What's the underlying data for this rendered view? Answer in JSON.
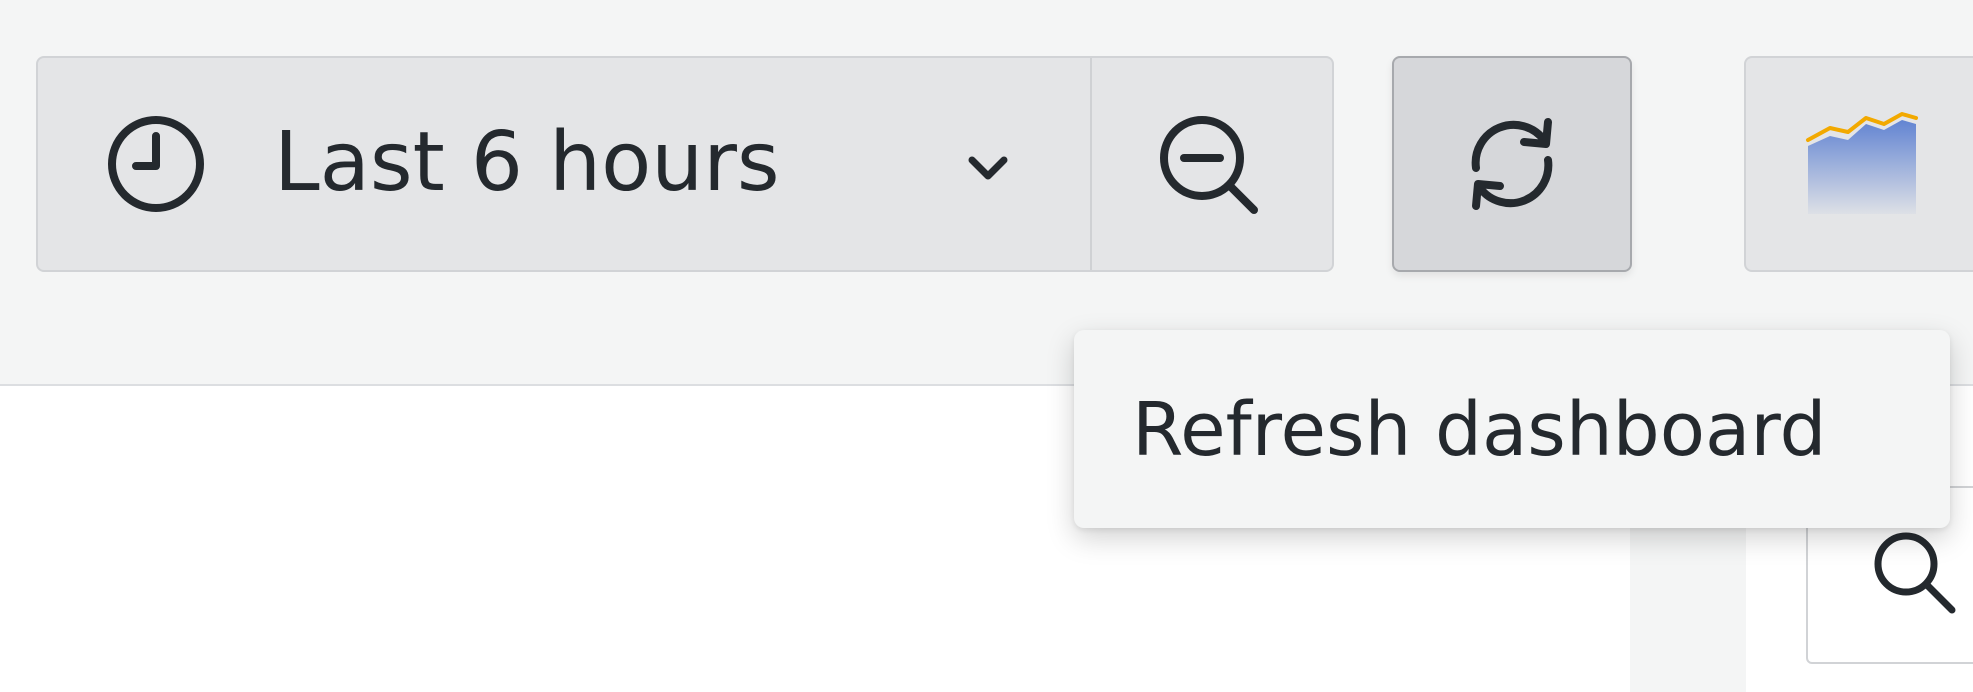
{
  "time_picker": {
    "label": "Last 6 hours",
    "icon": "clock-icon",
    "dropdown_icon": "chevron-down-icon"
  },
  "zoom_out": {
    "icon": "zoom-out-icon"
  },
  "refresh": {
    "icon": "refresh-icon",
    "tooltip": "Refresh dashboard"
  },
  "add_panel": {
    "icon": "chart-panel-icon"
  },
  "search": {
    "icon": "search-icon"
  },
  "colors": {
    "toolbar_bg": "#f4f5f5",
    "button_bg": "#e4e5e7",
    "active_button_bg": "#d6d7da",
    "text": "#24292e",
    "chart_line": "#f2a900",
    "chart_fill": "#5b7fd1"
  }
}
